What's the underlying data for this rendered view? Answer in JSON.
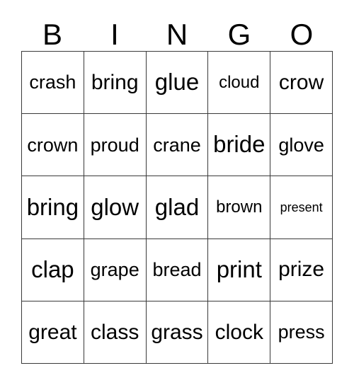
{
  "card": {
    "title": "BINGO",
    "columns": [
      "B",
      "I",
      "N",
      "G",
      "O"
    ],
    "rows": [
      {
        "cells": [
          {
            "text": "crash",
            "size": "md"
          },
          {
            "text": "bring",
            "size": "lg"
          },
          {
            "text": "glue",
            "size": "xl"
          },
          {
            "text": "cloud",
            "size": "sm"
          },
          {
            "text": "crow",
            "size": "lg"
          }
        ]
      },
      {
        "cells": [
          {
            "text": "crown",
            "size": "md"
          },
          {
            "text": "proud",
            "size": "md"
          },
          {
            "text": "crane",
            "size": "md"
          },
          {
            "text": "bride",
            "size": "xl"
          },
          {
            "text": "glove",
            "size": "md"
          }
        ]
      },
      {
        "cells": [
          {
            "text": "bring",
            "size": "xl"
          },
          {
            "text": "glow",
            "size": "xl"
          },
          {
            "text": "glad",
            "size": "xl"
          },
          {
            "text": "brown",
            "size": "sm"
          },
          {
            "text": "present",
            "size": "xs"
          }
        ]
      },
      {
        "cells": [
          {
            "text": "clap",
            "size": "xl"
          },
          {
            "text": "grape",
            "size": "md"
          },
          {
            "text": "bread",
            "size": "md"
          },
          {
            "text": "print",
            "size": "xl"
          },
          {
            "text": "prize",
            "size": "lg"
          }
        ]
      },
      {
        "cells": [
          {
            "text": "great",
            "size": "lg"
          },
          {
            "text": "class",
            "size": "lg"
          },
          {
            "text": "grass",
            "size": "lg"
          },
          {
            "text": "clock",
            "size": "lg"
          },
          {
            "text": "press",
            "size": "md"
          }
        ]
      }
    ]
  },
  "style": {
    "background_color": "#ffffff",
    "text_color": "#000000",
    "grid_line_color": "#3a3a3a"
  }
}
